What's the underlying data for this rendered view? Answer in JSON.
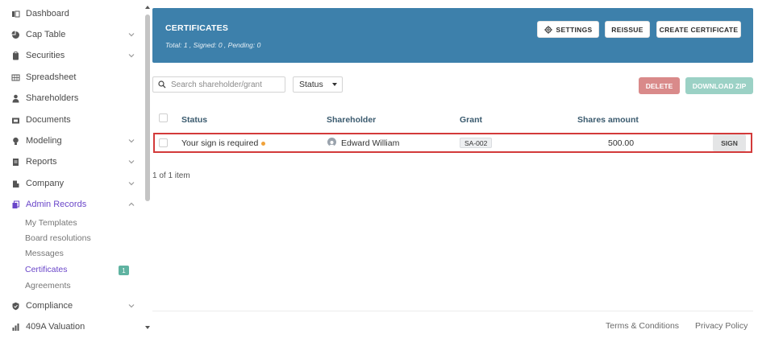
{
  "sidebar": {
    "items": [
      {
        "label": "Dashboard",
        "icon": "dashboard-icon",
        "chevron": false
      },
      {
        "label": "Cap Table",
        "icon": "pie-chart-icon",
        "chevron": true
      },
      {
        "label": "Securities",
        "icon": "clipboard-icon",
        "chevron": true
      },
      {
        "label": "Spreadsheet",
        "icon": "spreadsheet-icon",
        "chevron": false
      },
      {
        "label": "Shareholders",
        "icon": "person-icon",
        "chevron": false
      },
      {
        "label": "Documents",
        "icon": "folder-icon",
        "chevron": false
      },
      {
        "label": "Modeling",
        "icon": "lightbulb-icon",
        "chevron": true
      },
      {
        "label": "Reports",
        "icon": "report-icon",
        "chevron": true
      },
      {
        "label": "Company",
        "icon": "building-icon",
        "chevron": true
      },
      {
        "label": "Admin Records",
        "icon": "records-icon",
        "chevron": true
      },
      {
        "label": "Compliance",
        "icon": "shield-check-icon",
        "chevron": true
      },
      {
        "label": "409A Valuation",
        "icon": "chart-icon",
        "chevron": false
      }
    ],
    "admin_sub": [
      {
        "label": "My Templates"
      },
      {
        "label": "Board resolutions"
      },
      {
        "label": "Messages"
      },
      {
        "label": "Certificates"
      },
      {
        "label": "Agreements"
      }
    ],
    "certificates_badge": "1"
  },
  "header": {
    "title": "CERTIFICATES",
    "subtitle": "Total: 1 , Signed: 0 , Pending: 0",
    "settings_label": "SETTINGS",
    "reissue_label": "REISSUE",
    "create_label": "CREATE CERTIFICATE"
  },
  "toolbar": {
    "search_placeholder": "Search shareholder/grant",
    "status_label": "Status",
    "delete_label": "DELETE",
    "download_label": "DOWNLOAD ZIP"
  },
  "table": {
    "columns": [
      "Status",
      "Shareholder",
      "Grant",
      "Shares amount"
    ],
    "rows": [
      {
        "status": "Your sign is required",
        "shareholder": "Edward William",
        "grant": "SA-002",
        "shares": "500.00",
        "action": "SIGN"
      }
    ],
    "count_text": "1 of 1 item"
  },
  "footer": {
    "terms": "Terms & Conditions",
    "privacy": "Privacy Policy"
  },
  "colors": {
    "banner": "#3d80ab",
    "accent_purple": "#6a46c9",
    "highlight": "#d33a3a",
    "delete": "#d98a8a",
    "download": "#9bd1c5"
  }
}
